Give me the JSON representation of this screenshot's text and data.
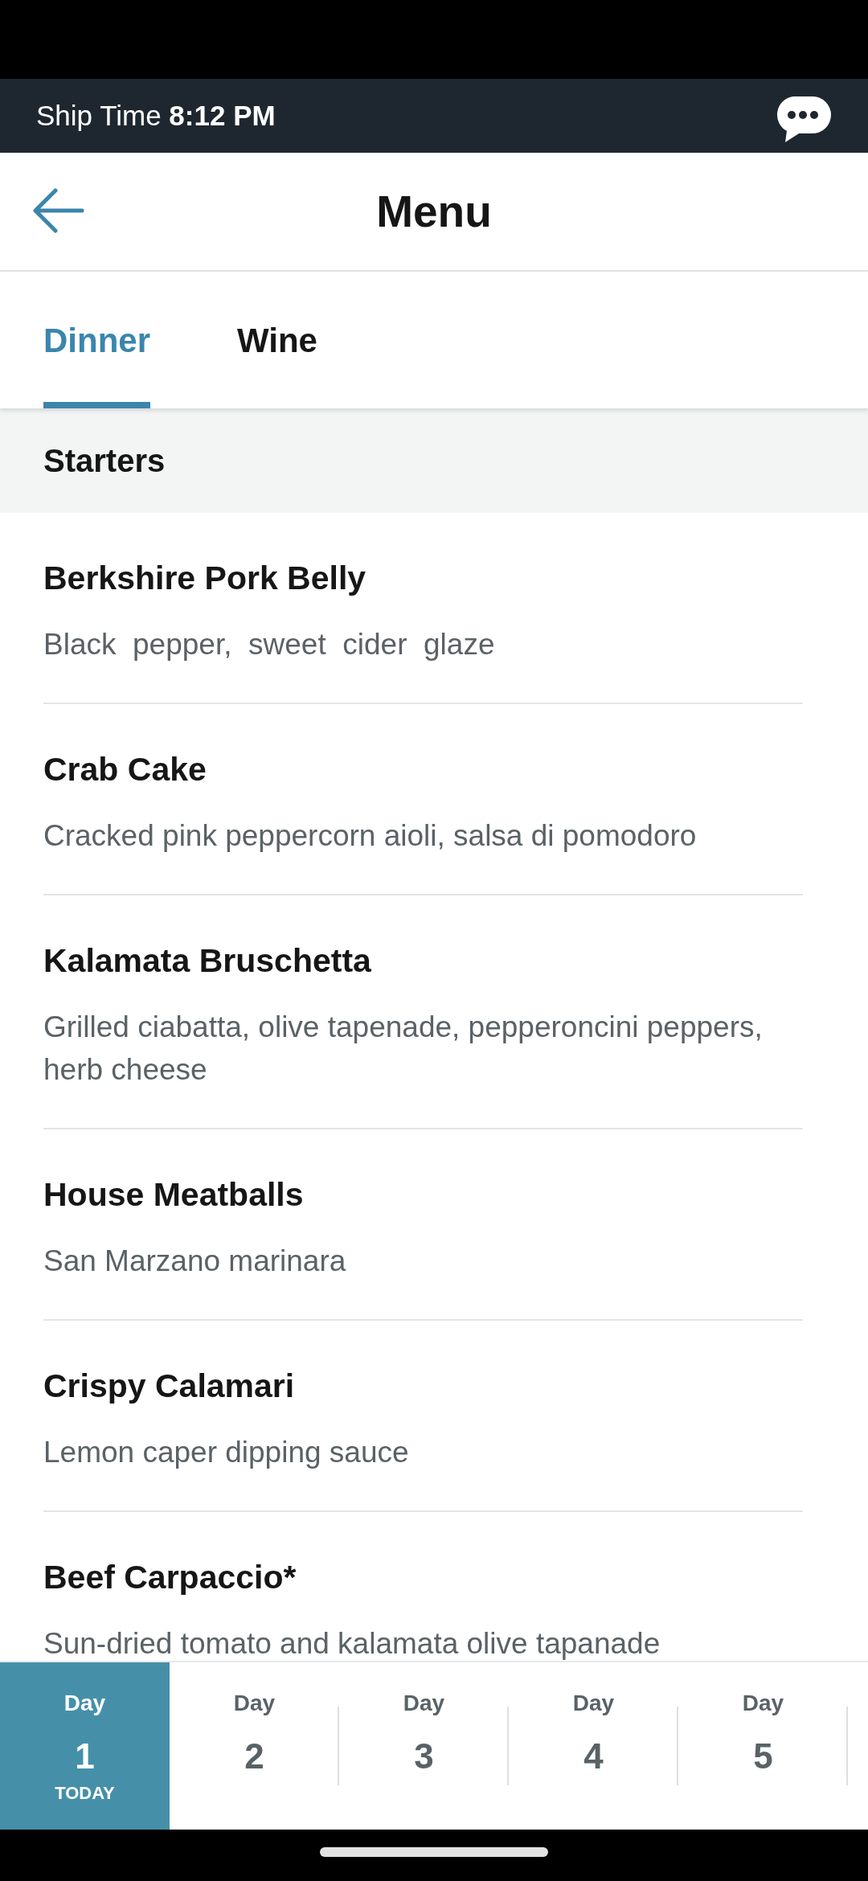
{
  "ship_time_bar": {
    "text": "Ship Time **8:12 PM**"
  },
  "header": {
    "title": "Menu"
  },
  "tabs": [
    {
      "label": "Dinner",
      "selected": true
    },
    {
      "label": "Wine",
      "selected": false
    }
  ],
  "section": {
    "title": "Starters"
  },
  "items": [
    {
      "name": "Berkshire Pork Belly",
      "description": "Black  pepper,  sweet  cider  glaze"
    },
    {
      "name": "Crab Cake",
      "description": "Cracked pink peppercorn aioli, salsa di pomodoro"
    },
    {
      "name": "Kalamata Bruschetta",
      "description": "Grilled ciabatta, olive tapenade, pepperoncini peppers, herb cheese"
    },
    {
      "name": "House Meatballs",
      "description": "San Marzano marinara"
    },
    {
      "name": "Crispy Calamari",
      "description": "Lemon caper dipping sauce"
    },
    {
      "name": "Beef Carpaccio*",
      "description": "Sun-dried tomato and kalamata olive tapanade"
    }
  ],
  "days": [
    {
      "label": "Day",
      "number": "1",
      "note": "TODAY",
      "selected": true
    },
    {
      "label": "Day",
      "number": "2",
      "selected": false
    },
    {
      "label": "Day",
      "number": "3",
      "selected": false
    },
    {
      "label": "Day",
      "number": "4",
      "selected": false
    },
    {
      "label": "Day",
      "number": "5",
      "selected": false
    }
  ]
}
